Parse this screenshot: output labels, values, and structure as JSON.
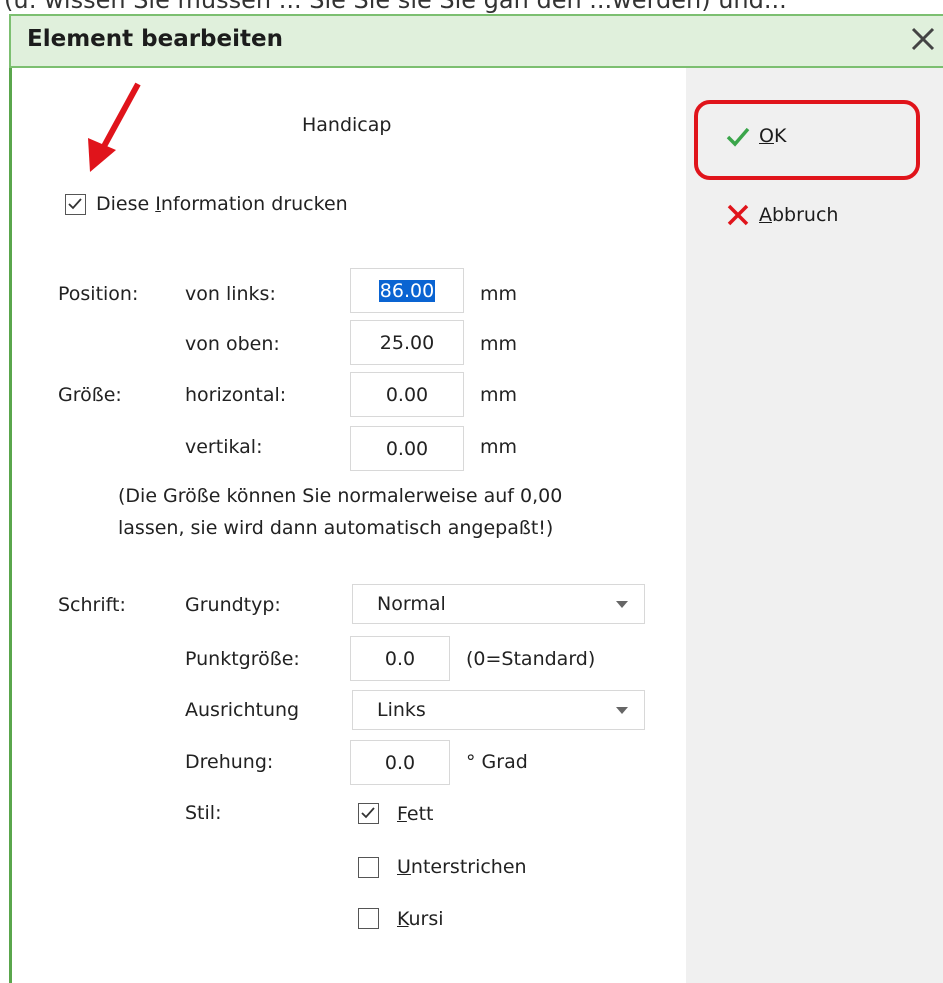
{
  "window": {
    "clipped_top_text": "(u: wissen Sie müssen ... Sie Sie sie Sie gan den ...werden) und...",
    "title": "Element bearbeiten"
  },
  "header_label": "Handicap",
  "print_checkbox": {
    "label_pre": "Diese ",
    "label_ul": "I",
    "label_post": "nformation drucken",
    "checked": true
  },
  "buttons": {
    "ok": {
      "label_ul": "O",
      "label_post": "K"
    },
    "cancel": {
      "label_ul": "A",
      "label_post": "bbruch"
    }
  },
  "position": {
    "section_label": "Position:",
    "left_label": "von links:",
    "left_value": "86.00",
    "top_label": "von oben:",
    "top_value": "25.00"
  },
  "size": {
    "section_label": "Größe:",
    "h_label": "horizontal:",
    "h_value": "0.00",
    "v_label": "vertikal:",
    "v_value": "0.00"
  },
  "unit": "mm",
  "hint_line1": "(Die Größe können Sie normalerweise auf 0,00",
  "hint_line2": "lassen, sie wird dann automatisch angepaßt!)",
  "font": {
    "section_label": "Schrift:",
    "type_label": "Grundtyp:",
    "type_value": "Normal",
    "size_label": "Punktgröße:",
    "size_value": "0.0",
    "size_hint": "(0=Standard)",
    "align_label": "Ausrichtung",
    "align_value": "Links",
    "rot_label": "Drehung:",
    "rot_value": "0.0",
    "rot_unit": "° Grad",
    "style_label": "Stil:",
    "bold": {
      "ul": "F",
      "rest": "ett",
      "checked": true
    },
    "underline": {
      "ul": "U",
      "rest": "nterstrichen",
      "checked": false
    },
    "italic": {
      "ul": "K",
      "rest": "ursi",
      "checked": false
    }
  },
  "colors": {
    "title_bg": "#e0f0dc",
    "border": "#7cbf70",
    "highlight": "#e0141b",
    "selection": "#0a64d2"
  }
}
